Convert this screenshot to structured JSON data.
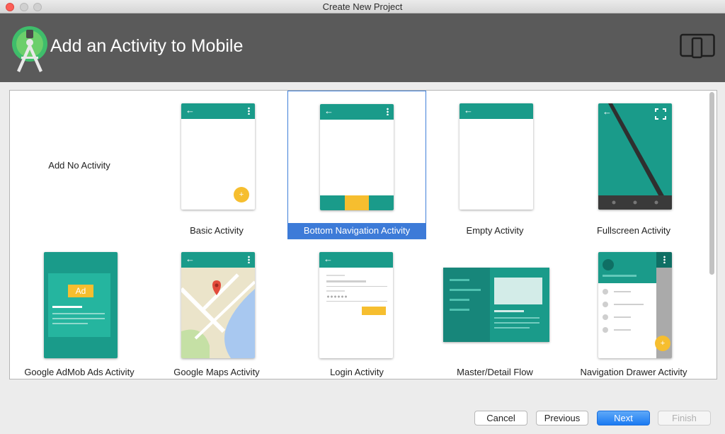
{
  "window": {
    "title": "Create New Project"
  },
  "header": {
    "title": "Add an Activity to Mobile",
    "logo_icon": "android-studio-logo",
    "device_icon": "phone-tablet-icon"
  },
  "gallery": {
    "items": [
      {
        "label": "Add No Activity"
      },
      {
        "label": "Basic Activity"
      },
      {
        "label": "Bottom Navigation Activity",
        "selected": true
      },
      {
        "label": "Empty Activity"
      },
      {
        "label": "Fullscreen Activity"
      },
      {
        "label": "Google AdMob Ads Activity",
        "badge": "Ad"
      },
      {
        "label": "Google Maps Activity"
      },
      {
        "label": "Login Activity"
      },
      {
        "label": "Master/Detail Flow"
      },
      {
        "label": "Navigation Drawer Activity"
      }
    ]
  },
  "buttons": {
    "cancel": "Cancel",
    "previous": "Previous",
    "next": "Next",
    "finish": "Finish"
  },
  "colors": {
    "accent": "#1a9b8a",
    "selection": "#3d7bd8",
    "fab": "#f6be2f",
    "header": "#5a5a5a"
  }
}
